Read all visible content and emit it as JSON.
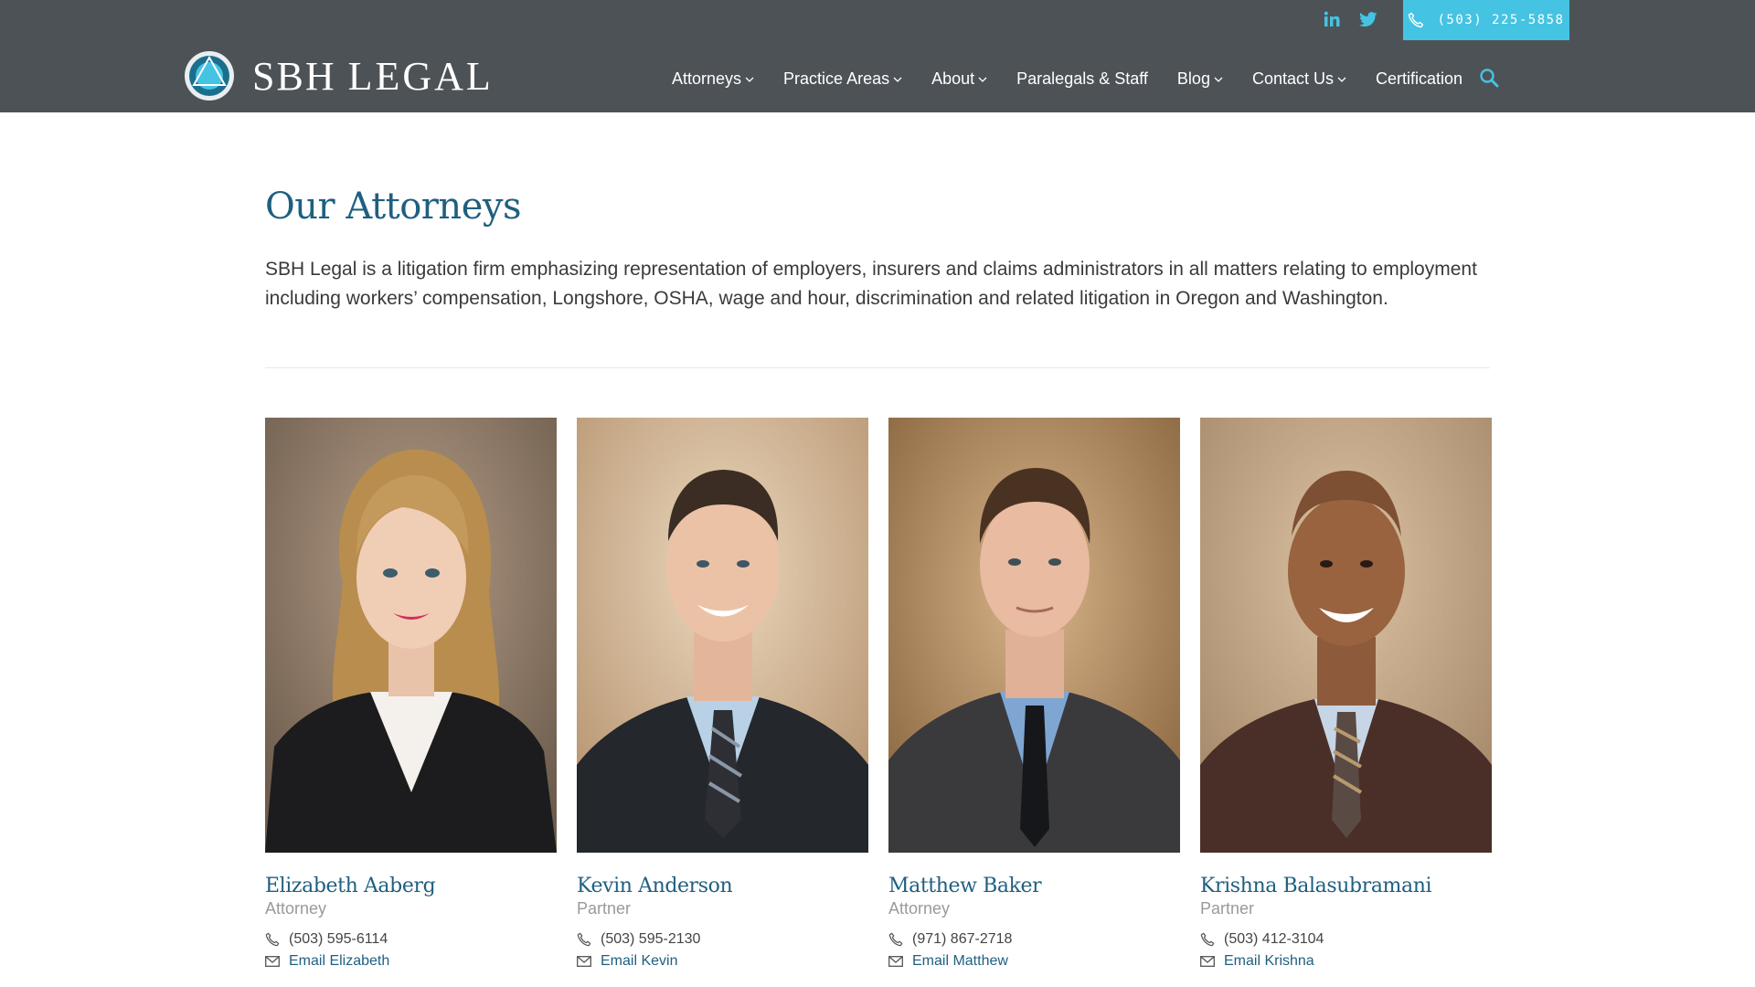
{
  "header": {
    "logo": {
      "brand": "SBH",
      "suffix": "LEGAL"
    },
    "social": [
      "linkedin-icon",
      "twitter-icon"
    ],
    "phone": "(503) 225-5858",
    "accent": "#45c3e2",
    "background": "#4d5257",
    "nav": [
      {
        "label": "Attorneys",
        "dropdown": true
      },
      {
        "label": "Practice Areas",
        "dropdown": true
      },
      {
        "label": "About",
        "dropdown": true
      },
      {
        "label": "Paralegals & Staff",
        "dropdown": false
      },
      {
        "label": "Blog",
        "dropdown": true
      },
      {
        "label": "Contact Us",
        "dropdown": true
      },
      {
        "label": "Certification",
        "dropdown": false
      }
    ]
  },
  "main": {
    "title": "Our Attorneys",
    "intro": "SBH Legal is a litigation firm emphasizing representation of employers, insurers and claims administrators in all matters relating to employment including workers’ compensation, Longshore, OSHA, wage and hour, discrimination and related litigation in Oregon and Washington.",
    "attorneys": [
      {
        "name": "Elizabeth Aaberg",
        "role": "Attorney",
        "phone": "(503) 595-6114",
        "email_label": "Email Elizabeth"
      },
      {
        "name": "Kevin Anderson",
        "role": "Partner",
        "phone": "(503) 595-2130",
        "email_label": "Email Kevin"
      },
      {
        "name": "Matthew Baker",
        "role": "Attorney",
        "phone": "(971) 867-2718",
        "email_label": "Email Matthew"
      },
      {
        "name": "Krishna Balasubramani",
        "role": "Partner",
        "phone": "(503) 412-3104",
        "email_label": "Email Krishna"
      }
    ]
  },
  "colors": {
    "title": "#1f5f80",
    "role": "#9a9a9a"
  }
}
